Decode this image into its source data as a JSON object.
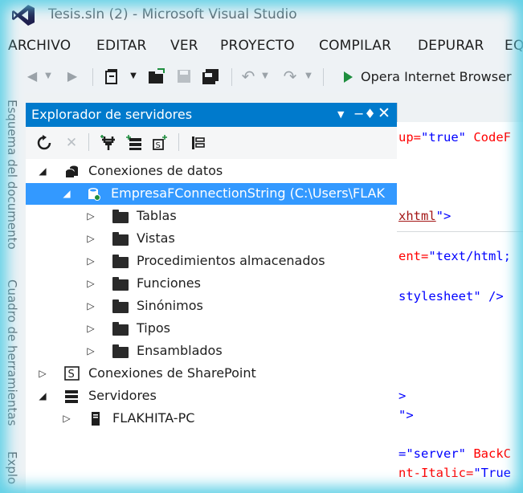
{
  "window": {
    "title": "Tesis.sln (2) - Microsoft Visual Studio"
  },
  "menu": [
    "ARCHIVO",
    "EDITAR",
    "VER",
    "PROYECTO",
    "COMPILAR",
    "DEPURAR",
    "EQ"
  ],
  "toolbar": {
    "run_label": "Opera Internet Browser"
  },
  "side_tabs": [
    "Esquema del documento",
    "Cuadro de herramientas",
    "Explo"
  ],
  "explorer": {
    "title": "Explorador de servidores",
    "tree": [
      {
        "label": "Conexiones de datos",
        "icon": "database-icon",
        "expanded": true
      },
      {
        "label": "EmpresaFConnectionString (C:\\Users\\FLAK",
        "icon": "connection-icon",
        "expanded": true,
        "selected": true
      },
      {
        "label": "Tablas",
        "icon": "folder-icon"
      },
      {
        "label": "Vistas",
        "icon": "folder-icon"
      },
      {
        "label": "Procedimientos almacenados",
        "icon": "folder-icon"
      },
      {
        "label": "Funciones",
        "icon": "folder-icon"
      },
      {
        "label": "Sinónimos",
        "icon": "folder-icon"
      },
      {
        "label": "Tipos",
        "icon": "folder-icon"
      },
      {
        "label": "Ensamblados",
        "icon": "folder-icon"
      },
      {
        "label": "Conexiones de SharePoint",
        "icon": "sharepoint-icon"
      },
      {
        "label": "Servidores",
        "icon": "servers-icon",
        "expanded": true
      },
      {
        "label": "FLAKHITA-PC",
        "icon": "server-icon"
      }
    ]
  },
  "editor": {
    "lines": [
      {
        "parts": [
          [
            "up=",
            "red"
          ],
          [
            "\"true\"",
            "blue"
          ],
          [
            " CodeF",
            "red"
          ]
        ]
      },
      {
        "parts": [
          [
            "xhtml",
            "maroon"
          ],
          [
            "\">",
            "blue"
          ]
        ]
      },
      {
        "parts": [
          [
            "ent=",
            "red"
          ],
          [
            "\"text/html;",
            "blue"
          ]
        ]
      },
      {
        "parts": [
          [
            "stylesheet\"",
            "blue"
          ],
          [
            " />",
            "blue"
          ]
        ]
      },
      {
        "parts": [
          [
            ">",
            "blue"
          ]
        ]
      },
      {
        "parts": [
          [
            "\">",
            "blue"
          ]
        ]
      },
      {
        "parts": [
          [
            "=",
            "blue"
          ],
          [
            "\"server\"",
            "blue"
          ],
          [
            " BackC",
            "red"
          ]
        ]
      },
      {
        "parts": [
          [
            "nt-Italic=",
            "red"
          ],
          [
            "\"True",
            "blue"
          ]
        ]
      }
    ]
  },
  "colors": {
    "accent": "#007acc",
    "selection": "#3399ff",
    "glow": "#5fd0e6"
  }
}
